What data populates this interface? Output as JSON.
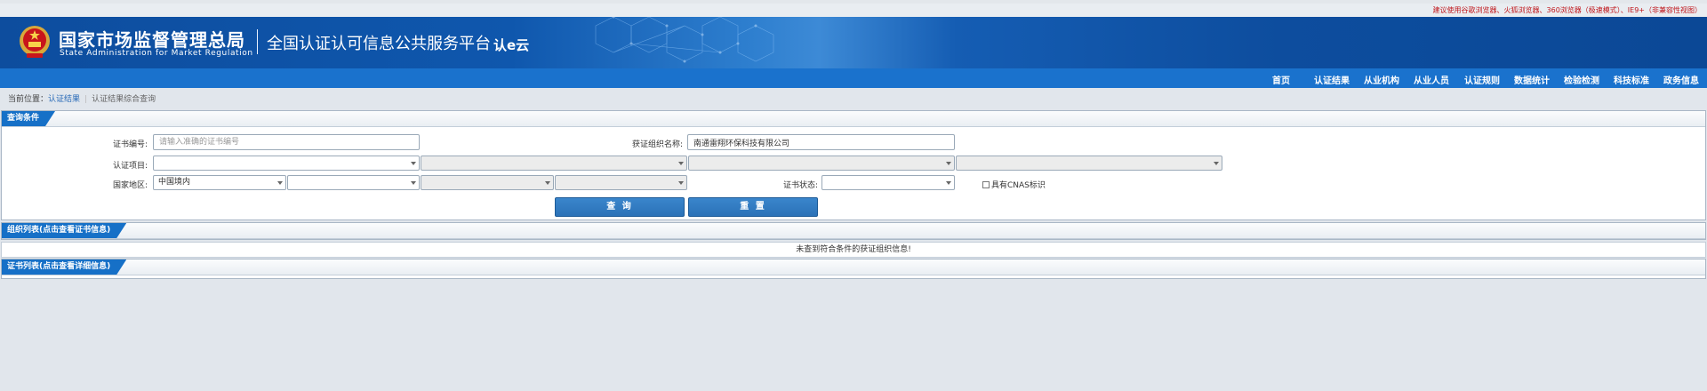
{
  "header": {
    "browser_notice": "建议使用谷歌浏览器、火狐浏览器、360浏览器（极速模式）、IE9+（非兼容性视图）",
    "org_name_cn": "国家市场监督管理总局",
    "org_name_en": "State Administration  for  Market Regulation",
    "platform_title": "全国认证认可信息公共服务平台",
    "logo_text": "认e云"
  },
  "nav": {
    "items": [
      "首页",
      "认证结果",
      "从业机构",
      "从业人员",
      "认证规则",
      "数据统计",
      "检验检测",
      "科技标准",
      "政务信息"
    ]
  },
  "breadcrumb": {
    "prefix": "当前位置：",
    "link": "认证结果",
    "current": "认证结果综合查询"
  },
  "query": {
    "title": "查询条件",
    "cert_no_label": "证书编号:",
    "cert_no_placeholder": "请输入准确的证书编号",
    "org_label": "获证组织名称:",
    "org_value": "南通雷翔环保科技有限公司",
    "project_label": "认证项目:",
    "region_label": "国家地区:",
    "region_value": "中国境内",
    "status_label": "证书状态:",
    "cnas_label": "具有CNAS标识",
    "search_button": "查 询",
    "reset_button": "重 置"
  },
  "org_list": {
    "title": "组织列表(点击查看证书信息)",
    "empty_message": "未查到符合条件的获证组织信息!"
  },
  "cert_list": {
    "title": "证书列表(点击查看详细信息)"
  },
  "colors": {
    "banner": "#0d4d9e",
    "nav": "#1a72cd",
    "tab": "#1670c7",
    "button": "#2b72b8",
    "notice": "#c0161b"
  }
}
